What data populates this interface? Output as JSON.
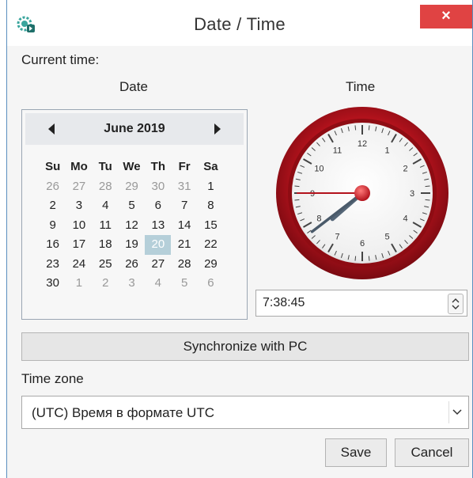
{
  "window": {
    "title": "Date / Time",
    "close_glyph": "×",
    "app_icon": "gear-clock-icon",
    "accent": "#e04343"
  },
  "labels": {
    "current_time": "Current time:",
    "date": "Date",
    "time": "Time",
    "time_zone": "Time zone"
  },
  "calendar": {
    "month_label": "June 2019",
    "weekdays": [
      "Su",
      "Mo",
      "Tu",
      "We",
      "Th",
      "Fr",
      "Sa"
    ],
    "weeks": [
      [
        "26",
        "27",
        "28",
        "29",
        "30",
        "31",
        "1"
      ],
      [
        "2",
        "3",
        "4",
        "5",
        "6",
        "7",
        "8"
      ],
      [
        "9",
        "10",
        "11",
        "12",
        "13",
        "14",
        "15"
      ],
      [
        "16",
        "17",
        "18",
        "19",
        "20",
        "21",
        "22"
      ],
      [
        "23",
        "24",
        "25",
        "26",
        "27",
        "28",
        "29"
      ],
      [
        "30",
        "1",
        "2",
        "3",
        "4",
        "5",
        "6"
      ]
    ],
    "selected_day": "20",
    "selected_color": "#b5cfd9"
  },
  "clock": {
    "numbers": [
      "12",
      "1",
      "2",
      "3",
      "4",
      "5",
      "6",
      "7",
      "8",
      "9",
      "10",
      "11"
    ],
    "hour": 7,
    "minute": 38,
    "second": 45,
    "rim_color": "#b3121c"
  },
  "time_input": {
    "value": "7:38:45"
  },
  "buttons": {
    "sync": "Synchronize with PC",
    "save": "Save",
    "cancel": "Cancel"
  },
  "timezone": {
    "value": "(UTC) Время в формате UTC"
  }
}
